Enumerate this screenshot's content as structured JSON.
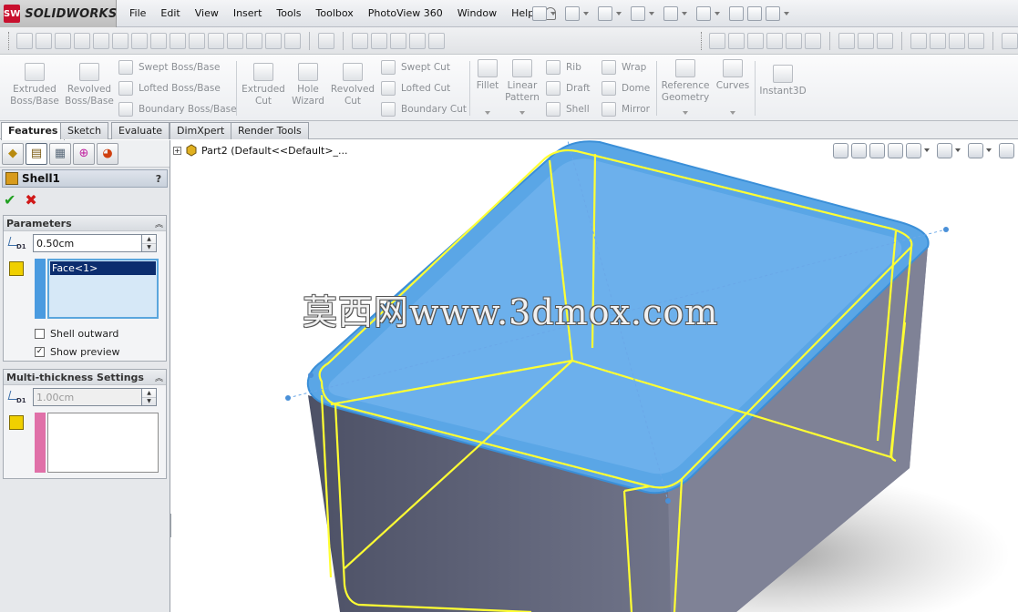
{
  "app": {
    "brand_badge": "SW",
    "brand_name": "SOLIDWORKS"
  },
  "menu": [
    "File",
    "Edit",
    "View",
    "Insert",
    "Tools",
    "Toolbox",
    "PhotoView 360",
    "Window",
    "Help"
  ],
  "commands": {
    "extruded_boss": "Extruded Boss/Base",
    "revolved_boss": "Revolved Boss/Base",
    "swept_boss": "Swept Boss/Base",
    "lofted_boss": "Lofted Boss/Base",
    "boundary_boss": "Boundary Boss/Base",
    "extruded_cut": "Extruded Cut",
    "hole_wizard": "Hole Wizard",
    "revolved_cut": "Revolved Cut",
    "swept_cut": "Swept Cut",
    "lofted_cut": "Lofted Cut",
    "boundary_cut": "Boundary Cut",
    "fillet": "Fillet",
    "linear_pattern": "Linear Pattern",
    "rib": "Rib",
    "draft": "Draft",
    "shell": "Shell",
    "wrap": "Wrap",
    "dome": "Dome",
    "mirror": "Mirror",
    "reference_geometry": "Reference Geometry",
    "curves": "Curves",
    "instant3d": "Instant3D"
  },
  "tabs": [
    "Features",
    "Sketch",
    "Evaluate",
    "DimXpert",
    "Render Tools"
  ],
  "property_manager": {
    "title": "Shell1",
    "help": "?",
    "ok": "✔",
    "cancel": "✖",
    "parameters": {
      "title": "Parameters",
      "thickness": "0.50cm",
      "faces": [
        "Face<1>"
      ],
      "shell_outward_label": "Shell outward",
      "shell_outward": false,
      "show_preview_label": "Show preview",
      "show_preview": true
    },
    "multi_thickness": {
      "title": "Multi-thickness Settings",
      "thickness": "1.00cm"
    }
  },
  "feature_tree": {
    "root": "Part2  (Default<<Default>_..."
  },
  "watermark": "莫西网www.3dmox.com",
  "colors": {
    "brand": "#c8102e",
    "selection_blue": "#5aa6e6",
    "preview_yellow": "#ffff33",
    "body_gray": "#6a6e82"
  }
}
